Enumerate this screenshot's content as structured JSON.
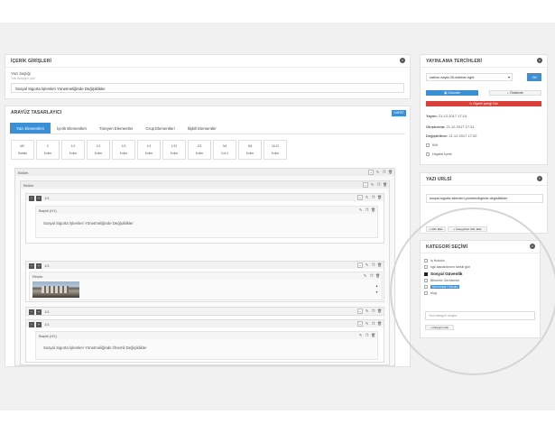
{
  "content": {
    "title": "İÇERİK GİRİŞLERİ",
    "field_label": "Yazı başlığı",
    "field_hint": "Yazı Başlığını girin",
    "field_value": "Sosyal Sigorta İşlemleri Yönetmeliğinde Değişiklikler"
  },
  "designer": {
    "title": "ARAYÜZ TASARLAYICI",
    "close_label": "KAPAT",
    "tabs": [
      "Yazı Elementleri",
      "İçerik Elementleri",
      "Türeyen Elementler",
      "Grup Elementleri",
      "İlişkili Elementler"
    ],
    "blocks": [
      {
        "top": "MC",
        "bottom": "Sarlalo"
      },
      {
        "top": "C",
        "bottom": "Kolon"
      },
      {
        "top": "1/1",
        "bottom": "Kolon"
      },
      {
        "top": "1/2",
        "bottom": "Kolon"
      },
      {
        "top": "1/3",
        "bottom": "Kolon"
      },
      {
        "top": "1/4",
        "bottom": "Kolon"
      },
      {
        "top": "1/12",
        "bottom": "Kolon"
      },
      {
        "top": "2/3",
        "bottom": "Kolon"
      },
      {
        "top": "3/4",
        "bottom": "Col-4"
      },
      {
        "top": "5/6",
        "bottom": "Kolon"
      },
      {
        "top": "11/12",
        "bottom": "Kolon"
      }
    ],
    "section_label": "Bölüm",
    "subsection_label": "Bölüm",
    "col_label": "1/1",
    "heading1_label": "Başlık (H1)",
    "heading1_text": "Sosyal Sigorta İşlemleri Yönetmeliğinde Değişiklikler",
    "image_label": "Resim",
    "heading2_label": "Başlık (H2)",
    "heading2_text": "Sosyal Sigorta İşlemleri Yönetmeliğinde Önemli Değişiklikler"
  },
  "publish": {
    "title": "YAYINLAMA TERCİHLERİ",
    "template_value": "sablon-sayfa-05-sidebar-right",
    "apply_label": "Git",
    "update_label": "Güncelle",
    "preview_label": "Önizleme",
    "delete_label": "Ölçekli İçeriği Gör",
    "yayim_label": "Yayım:",
    "yayim_value": "21.12.2017 17:14",
    "olusturma_label": "Oluşturma:",
    "olusturma_value": "21.12.2017 17:31",
    "degistirilme_label": "Değiştirilme:",
    "degistirilme_value": "21.12.2017 17:32",
    "option1": "Kilit",
    "option2": "Hayalet İçerik"
  },
  "url": {
    "title": "YAZI URLSİ",
    "value": "sosyal-sigorta-islemleri-yonetmeliginde-degisiklikler",
    "add_url": "URL Ekle",
    "categories_url": "Kategorileri URL Ekle"
  },
  "category": {
    "title": "KATEGORİ SEÇİMİ",
    "items": [
      {
        "label": "İş Hukuku",
        "checked": false,
        "bold": false,
        "highlight": false
      },
      {
        "label": "sgk alacaklarının tahsili gün",
        "checked": false,
        "bold": false,
        "highlight": false
      },
      {
        "label": "Sosyal Güvenlik",
        "checked": true,
        "bold": true,
        "highlight": false
      },
      {
        "label": "Bilmeniz Gerekenler",
        "checked": false,
        "bold": false,
        "highlight": false
      },
      {
        "label": "Yazılımsal Hukuku",
        "checked": false,
        "bold": false,
        "highlight": true
      },
      {
        "label": "blog",
        "checked": false,
        "bold": false,
        "highlight": false
      }
    ],
    "new_placeholder": "Yeni kategori oluştur",
    "add_label": "Kategori ekle"
  }
}
